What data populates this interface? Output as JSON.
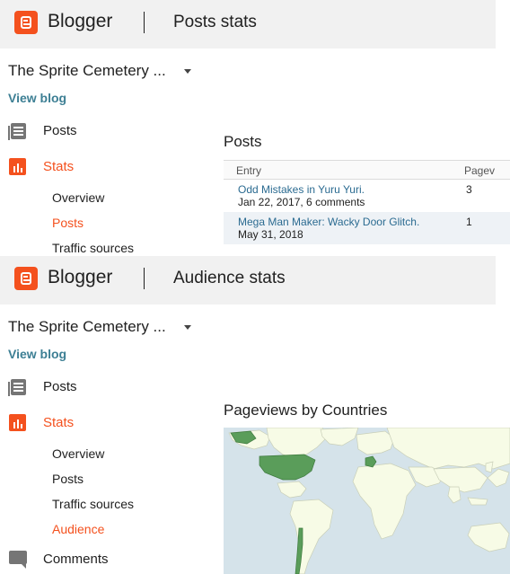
{
  "brand": "Blogger",
  "panels": {
    "posts": {
      "page_title": "Posts stats",
      "blog_name": "The Sprite Cemetery ...",
      "view_blog": "View blog",
      "nav": {
        "posts": "Posts",
        "stats": "Stats"
      },
      "sub_nav": [
        "Overview",
        "Posts",
        "Traffic sources"
      ],
      "active_sub": "Posts",
      "section_title": "Posts",
      "table": {
        "headers": [
          "Entry",
          "Pagev"
        ],
        "rows": [
          {
            "title": "Odd Mistakes in Yuru Yuri.",
            "meta": "Jan 22, 2017, 6 comments",
            "views": "3"
          },
          {
            "title": "Mega Man Maker: Wacky Door Glitch.",
            "meta": "May 31, 2018",
            "views": "1"
          }
        ]
      }
    },
    "audience": {
      "page_title": "Audience stats",
      "blog_name": "The Sprite Cemetery ...",
      "view_blog": "View blog",
      "nav": {
        "posts": "Posts",
        "stats": "Stats",
        "comments": "Comments"
      },
      "sub_nav": [
        "Overview",
        "Posts",
        "Traffic sources",
        "Audience"
      ],
      "active_sub": "Audience",
      "section_title": "Pageviews by Countries",
      "map": {
        "ocean_color": "#d5e3ea",
        "land_color": "#f7fbe6",
        "highlight_color": "#5a9d5a",
        "highlighted_countries": [
          "United States",
          "France",
          "Chile"
        ]
      }
    }
  },
  "colors": {
    "accent": "#f4511e",
    "link": "#3d7f94",
    "entry_link": "#2b6b91",
    "topbar": "#f1f1f1"
  }
}
